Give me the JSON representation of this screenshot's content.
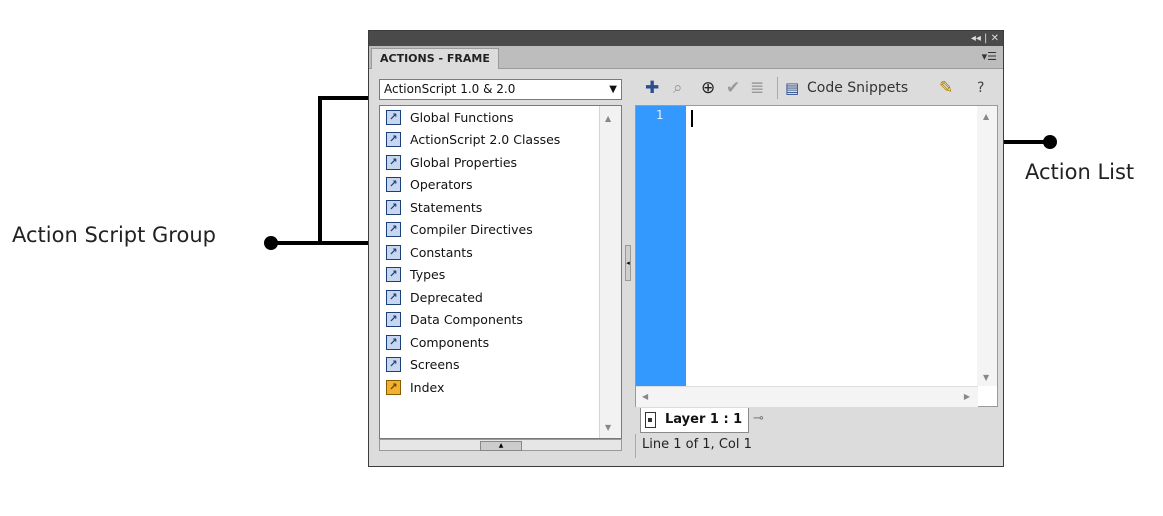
{
  "annotations": {
    "left_label": "Action Script Group",
    "right_label": "Action List"
  },
  "window": {
    "tab_title": "ACTIONS - FRAME",
    "titlebar_controls": "◂◂ | ✕",
    "panel_menu_icon": "menu-lines-icon"
  },
  "toolbox": {
    "version_select": "ActionScript 1.0 & 2.0",
    "items": [
      {
        "label": "Global Functions",
        "icon": "book-icon"
      },
      {
        "label": "ActionScript 2.0 Classes",
        "icon": "book-icon"
      },
      {
        "label": "Global Properties",
        "icon": "book-icon"
      },
      {
        "label": "Operators",
        "icon": "book-icon"
      },
      {
        "label": "Statements",
        "icon": "book-icon"
      },
      {
        "label": "Compiler Directives",
        "icon": "book-icon"
      },
      {
        "label": "Constants",
        "icon": "book-icon"
      },
      {
        "label": "Types",
        "icon": "book-icon"
      },
      {
        "label": "Deprecated",
        "icon": "book-icon"
      },
      {
        "label": "Data Components",
        "icon": "book-icon"
      },
      {
        "label": "Components",
        "icon": "book-icon"
      },
      {
        "label": "Screens",
        "icon": "book-icon"
      },
      {
        "label": "Index",
        "icon": "index-book-icon"
      }
    ]
  },
  "toolbar": {
    "code_snippets_label": "Code Snippets"
  },
  "editor": {
    "line_number": "1",
    "gutter_color": "#3399ff"
  },
  "footer": {
    "layer_tab": "Layer 1 : 1",
    "status": "Line 1 of 1, Col 1"
  }
}
